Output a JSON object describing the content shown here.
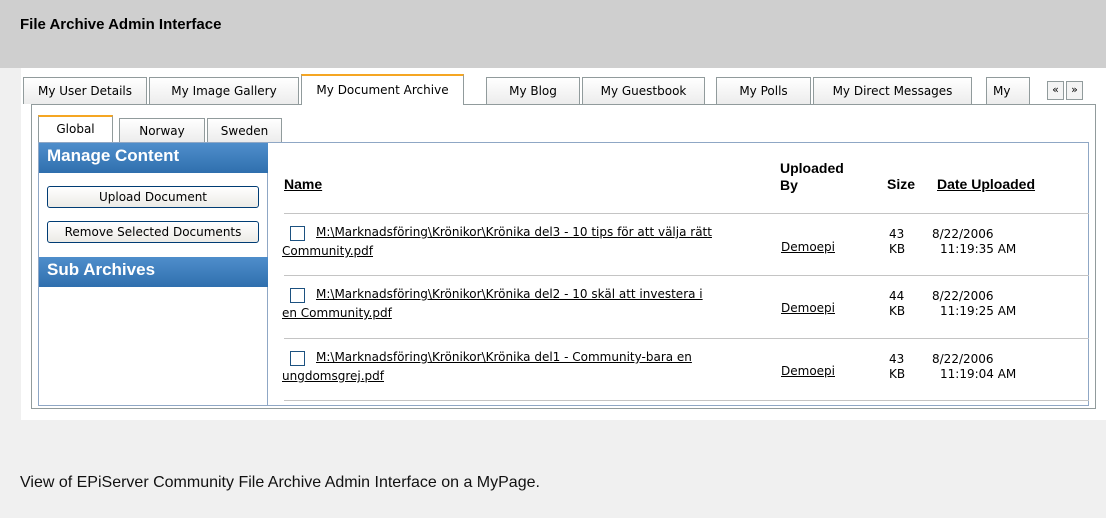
{
  "header": {
    "title": "File Archive Admin Interface"
  },
  "main_tabs": [
    {
      "label": "My User Details"
    },
    {
      "label": "My Image Gallery"
    },
    {
      "label": "My Document Archive",
      "active": true
    },
    {
      "label": "My Blog"
    },
    {
      "label": "My Guestbook"
    },
    {
      "label": "My Polls"
    },
    {
      "label": "My Direct Messages"
    },
    {
      "label": "My"
    }
  ],
  "tab_scroll": {
    "left": "«",
    "right": "»"
  },
  "sub_tabs": [
    {
      "label": "Global",
      "active": true
    },
    {
      "label": "Norway"
    },
    {
      "label": "Sweden"
    }
  ],
  "sidebar": {
    "manage_title": "Manage Content",
    "upload_label": "Upload Document",
    "remove_label": "Remove Selected Documents",
    "sub_archives_title": "Sub Archives"
  },
  "table": {
    "headers": {
      "name": "Name",
      "uploaded_by_1": "Uploaded",
      "uploaded_by_2": "By",
      "size": "Size",
      "date": "Date Uploaded"
    },
    "rows": [
      {
        "name_line1": "M:\\Marknadsföring\\Krönikor\\Krönika del3 - 10 tips för att välja rätt",
        "name_line2": "Community.pdf",
        "uploaded_by": "Demoepi",
        "size_num": "43",
        "size_unit": "KB",
        "date": "8/22/2006",
        "time": "11:19:35 AM"
      },
      {
        "name_line1": "M:\\Marknadsföring\\Krönikor\\Krönika del2 - 10 skäl att investera i",
        "name_line2": "en Community.pdf",
        "uploaded_by": "Demoepi",
        "size_num": "44",
        "size_unit": "KB",
        "date": "8/22/2006",
        "time": "11:19:25 AM"
      },
      {
        "name_line1": "M:\\Marknadsföring\\Krönikor\\Krönika del1 - Community-bara en",
        "name_line2": "ungdomsgrej.pdf",
        "uploaded_by": "Demoepi",
        "size_num": "43",
        "size_unit": "KB",
        "date": "8/22/2006",
        "time": "11:19:04 AM"
      }
    ]
  },
  "caption": "View of EPiServer Community File Archive Admin Interface on a MyPage."
}
